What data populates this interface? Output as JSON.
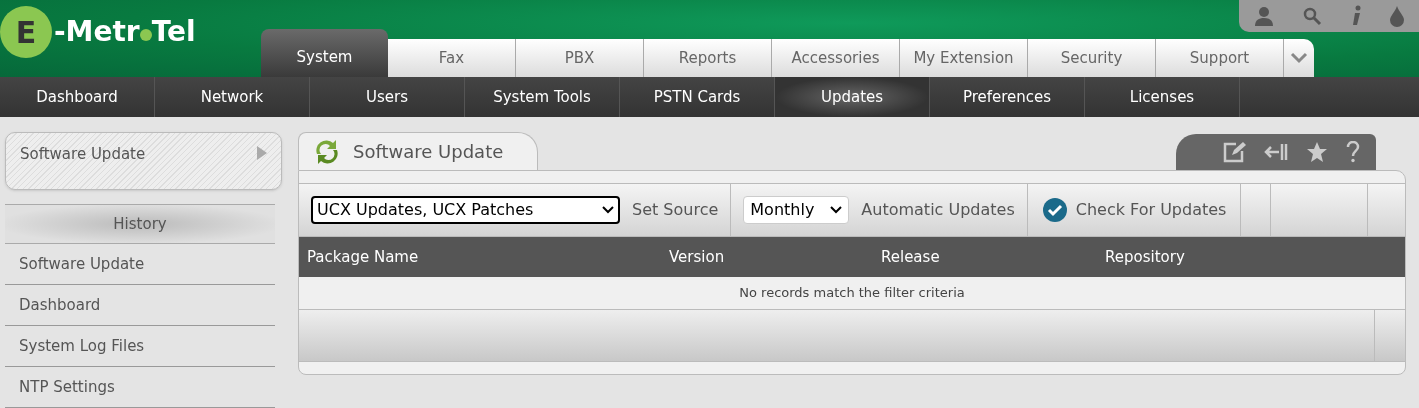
{
  "logo": {
    "initial": "E",
    "left": "-Metr",
    "right": "Tel"
  },
  "main_tabs": [
    {
      "label": "System",
      "selected": true
    },
    {
      "label": "Fax",
      "selected": false
    },
    {
      "label": "PBX",
      "selected": false
    },
    {
      "label": "Reports",
      "selected": false
    },
    {
      "label": "Accessories",
      "selected": false
    },
    {
      "label": "My Extension",
      "selected": false
    },
    {
      "label": "Security",
      "selected": false
    },
    {
      "label": "Support",
      "selected": false
    }
  ],
  "sub_nav": [
    {
      "label": "Dashboard",
      "selected": false
    },
    {
      "label": "Network",
      "selected": false
    },
    {
      "label": "Users",
      "selected": false
    },
    {
      "label": "System Tools",
      "selected": false
    },
    {
      "label": "PSTN Cards",
      "selected": false
    },
    {
      "label": "Updates",
      "selected": true
    },
    {
      "label": "Preferences",
      "selected": false
    },
    {
      "label": "Licenses",
      "selected": false
    }
  ],
  "sidebar": {
    "current": "Software Update",
    "history_title": "History",
    "history": [
      "Software Update",
      "Dashboard",
      "System Log Files",
      "NTP Settings"
    ]
  },
  "panel": {
    "title": "Software Update",
    "toolbar": {
      "source": "UCX Updates, UCX Patches",
      "set_source": "Set Source",
      "frequency": "Monthly",
      "automatic": "Automatic Updates",
      "check": "Check For Updates"
    },
    "columns": [
      "Package Name",
      "Version",
      "Release",
      "Repository"
    ],
    "empty_message": "No records match the filter criteria"
  }
}
